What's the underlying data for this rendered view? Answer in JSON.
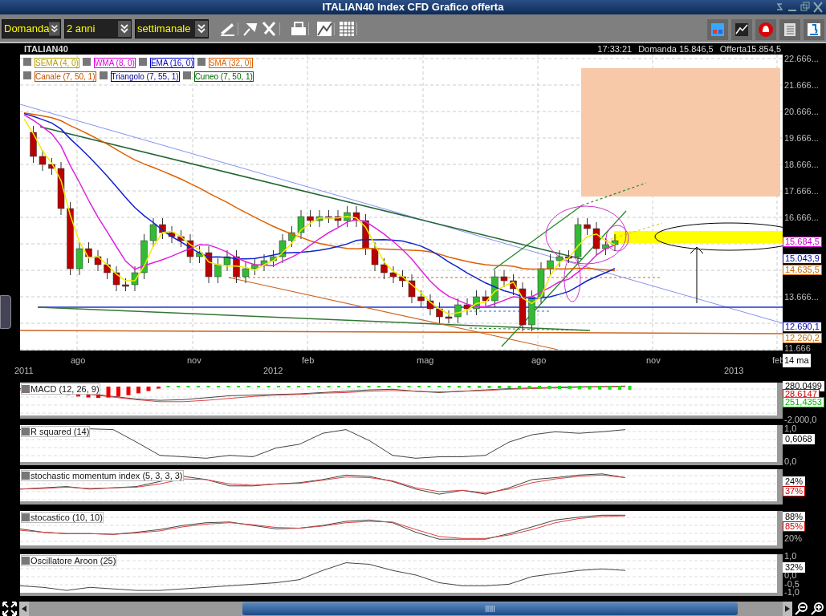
{
  "window": {
    "title": "ITALIAN40 Index CFD Grafico offerta"
  },
  "toolbar": {
    "dropdowns": [
      {
        "value": "Domanda"
      },
      {
        "value": "2 anni"
      },
      {
        "value": "settimanale"
      }
    ]
  },
  "chart": {
    "symbol": "ITALIAN40",
    "time": "17:33:21",
    "bid": "Domanda 15.846,5",
    "ask": "Offerta15.854,5",
    "legend_rows": [
      [
        {
          "label": "SEMA (4, 0)",
          "color": "#b8a000"
        },
        {
          "label": "WMA (8, 0)",
          "color": "#e000e0"
        },
        {
          "label": "EMA (16, 0)",
          "color": "#0000cc"
        },
        {
          "label": "SMA (32, 0)",
          "color": "#e06000"
        }
      ],
      [
        {
          "label": "Canale (7, 50, 1)",
          "color": "#c05000"
        },
        {
          "label": "Triangolo (7, 55, 1)",
          "color": "#000090"
        },
        {
          "label": "Cuneo (7, 50, 1)",
          "color": "#006600"
        }
      ]
    ],
    "y_labels": [
      "22.666...",
      "21.666...",
      "20.666...",
      "19.666...",
      "18.666...",
      "17.666...",
      "16.666...",
      "13.666...",
      "11.666"
    ],
    "price_tags": [
      {
        "text": "15.684,5",
        "color": "#cc00cc"
      },
      {
        "text": "15.043,9",
        "color": "#000099"
      },
      {
        "text": "14.635,5",
        "color": "#cc6600"
      },
      {
        "text": "12.690,1",
        "color": "#000099"
      },
      {
        "text": "12.260,2",
        "color": "#cc6600"
      }
    ],
    "x_months": [
      "ago",
      "nov",
      "feb",
      "mag",
      "ago",
      "nov",
      "feb"
    ],
    "x_years": [
      "2011",
      "2012",
      "2013"
    ],
    "cursor_date": "14 ma"
  },
  "indicators": [
    {
      "name": "MACD (12, 26, 9)",
      "labels": [
        "-2.000,0"
      ],
      "tags": [
        {
          "text": "280,0499"
        },
        {
          "text": "28,6147",
          "color": "#cc0000"
        },
        {
          "text": "251,4353",
          "color": "#00bb00"
        }
      ]
    },
    {
      "name": "R squared (14)",
      "labels": [
        "1,0",
        "0,0"
      ],
      "tags": [
        {
          "text": "0,6068"
        }
      ]
    },
    {
      "name": "stochastic momentum index (5, 3, 3, 3)",
      "tags": [
        {
          "text": "24%"
        },
        {
          "text": "37%",
          "color": "#cc0000"
        }
      ]
    },
    {
      "name": "stocastico (10, 10)",
      "labels": [
        "20%"
      ],
      "tags": [
        {
          "text": "88%"
        },
        {
          "text": "85%",
          "color": "#cc0000"
        }
      ]
    },
    {
      "name": "Oscillatore Aroon (25)",
      "labels": [
        "1,0",
        "0,0",
        "-0,5",
        "-1,0"
      ],
      "tags": [
        {
          "text": "32%"
        }
      ]
    }
  ]
}
